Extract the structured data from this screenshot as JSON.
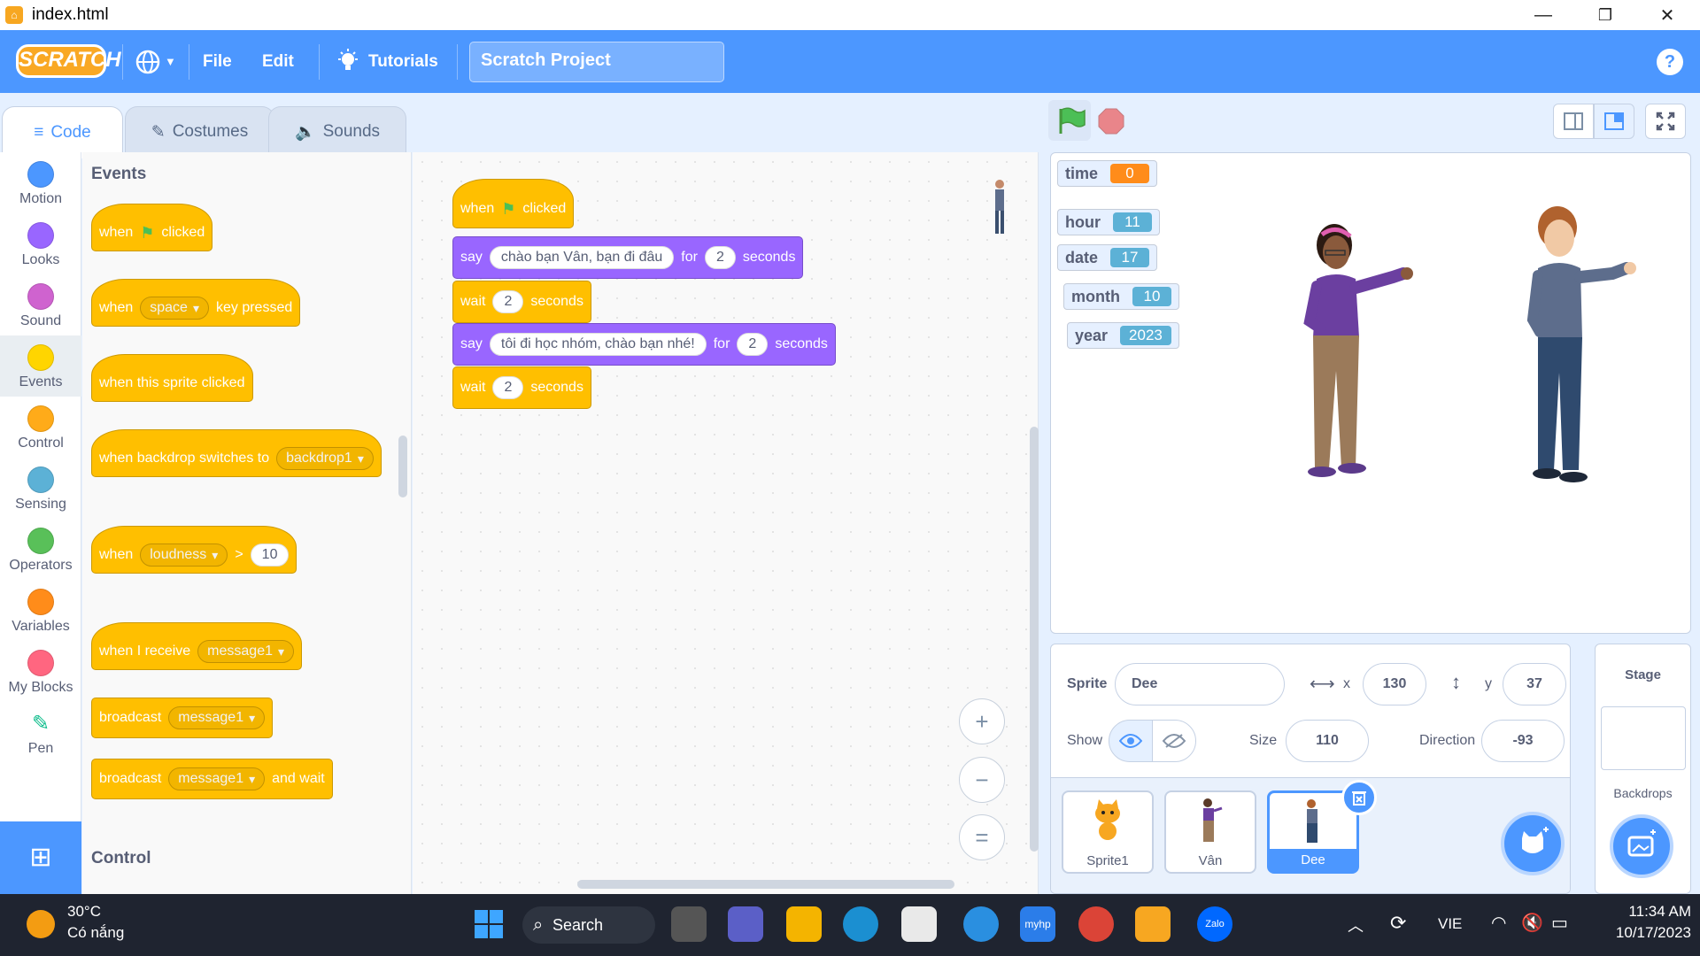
{
  "window": {
    "title": "index.html",
    "buttons": [
      "—",
      "❐",
      "✕"
    ]
  },
  "menu": {
    "logo": "SCRATCH",
    "language_icon": "globe-icon",
    "file": "File",
    "edit": "Edit",
    "tutorials": "Tutorials",
    "project_title": "Scratch Project",
    "help": "?"
  },
  "tabs": {
    "code": "Code",
    "costumes": "Costumes",
    "sounds": "Sounds"
  },
  "categories": [
    {
      "label": "Motion",
      "color": "#4c97ff"
    },
    {
      "label": "Looks",
      "color": "#9966ff"
    },
    {
      "label": "Sound",
      "color": "#cf63cf"
    },
    {
      "label": "Events",
      "color": "#ffd500"
    },
    {
      "label": "Control",
      "color": "#ffab19"
    },
    {
      "label": "Sensing",
      "color": "#5cb1d6"
    },
    {
      "label": "Operators",
      "color": "#59c059"
    },
    {
      "label": "Variables",
      "color": "#ff8c1a"
    },
    {
      "label": "My Blocks",
      "color": "#ff6680"
    },
    {
      "label": "Pen",
      "color": "#0fbd8c"
    }
  ],
  "palette": {
    "events_header": "Events",
    "control_header": "Control",
    "when": "when",
    "clicked": "clicked",
    "space": "space",
    "key_pressed": "key pressed",
    "sprite_clicked": "when this sprite clicked",
    "backdrop_switches": "when backdrop switches to",
    "backdrop1": "backdrop1",
    "loudness": "loudness",
    "gt": ">",
    "loudness_val": "10",
    "when_receive": "when I receive",
    "message1": "message1",
    "broadcast": "broadcast",
    "and_wait": "and wait"
  },
  "script": {
    "when": "when",
    "clicked": "clicked",
    "say": "say",
    "say1_text": "chào bạn Vân, bạn đi đâu",
    "for": "for",
    "say1_secs": "2",
    "seconds": "seconds",
    "wait": "wait",
    "wait1": "2",
    "say2_text": "tôi đi học nhóm, chào bạn nhé!",
    "say2_secs": "2",
    "wait2": "2"
  },
  "zoom": {
    "in": "+",
    "out": "−",
    "reset": "="
  },
  "monitors": [
    {
      "name": "time",
      "value": "0",
      "color": "#ff8c1a"
    },
    {
      "name": "hour",
      "value": "11",
      "color": "#5cb1d6"
    },
    {
      "name": "date",
      "value": "17",
      "color": "#5cb1d6"
    },
    {
      "name": "month",
      "value": "10",
      "color": "#5cb1d6"
    },
    {
      "name": "year",
      "value": "2023",
      "color": "#5cb1d6"
    }
  ],
  "sprite_info": {
    "sprite_label": "Sprite",
    "sprite_name": "Dee",
    "x_label": "x",
    "x": "130",
    "y_label": "y",
    "y": "37",
    "show_label": "Show",
    "size_label": "Size",
    "size": "110",
    "direction_label": "Direction",
    "direction": "-93"
  },
  "sprites": [
    "Sprite1",
    "Vân",
    "Dee"
  ],
  "stage_pane": {
    "title": "Stage",
    "backdrops": "Backdrops"
  },
  "taskbar": {
    "temp": "30°C",
    "weather": "Có nắng",
    "search": "Search",
    "lang": "VIE",
    "time": "11:34 AM",
    "date": "10/17/2023"
  }
}
